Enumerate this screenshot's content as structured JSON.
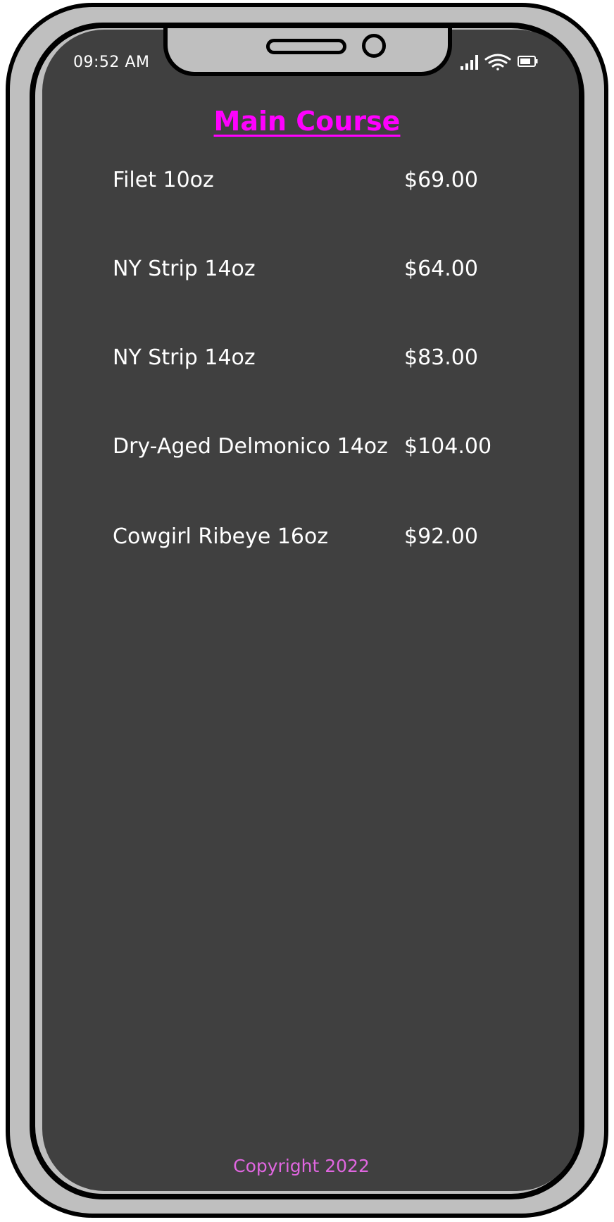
{
  "status_bar": {
    "time": "09:52 AM",
    "icons": [
      "signal-icon",
      "wifi-icon",
      "battery-icon"
    ]
  },
  "menu": {
    "title": "Main Course",
    "items": [
      {
        "name": "Filet 10oz",
        "price": "$69.00"
      },
      {
        "name": "NY Strip 14oz",
        "price": "$64.00"
      },
      {
        "name": "NY Strip 14oz",
        "price": "$83.00"
      },
      {
        "name": "Dry-Aged Delmonico 14oz",
        "price": "$104.00"
      },
      {
        "name": "Cowgirl Ribeye 16oz",
        "price": "$92.00"
      }
    ]
  },
  "footer": {
    "copyright": "Copyright 2022"
  },
  "colors": {
    "screen_background": "#404040",
    "title": "#ff00ff",
    "item_text": "#ffffff",
    "copyright": "#e066e0",
    "frame": "#bfbfbf"
  }
}
